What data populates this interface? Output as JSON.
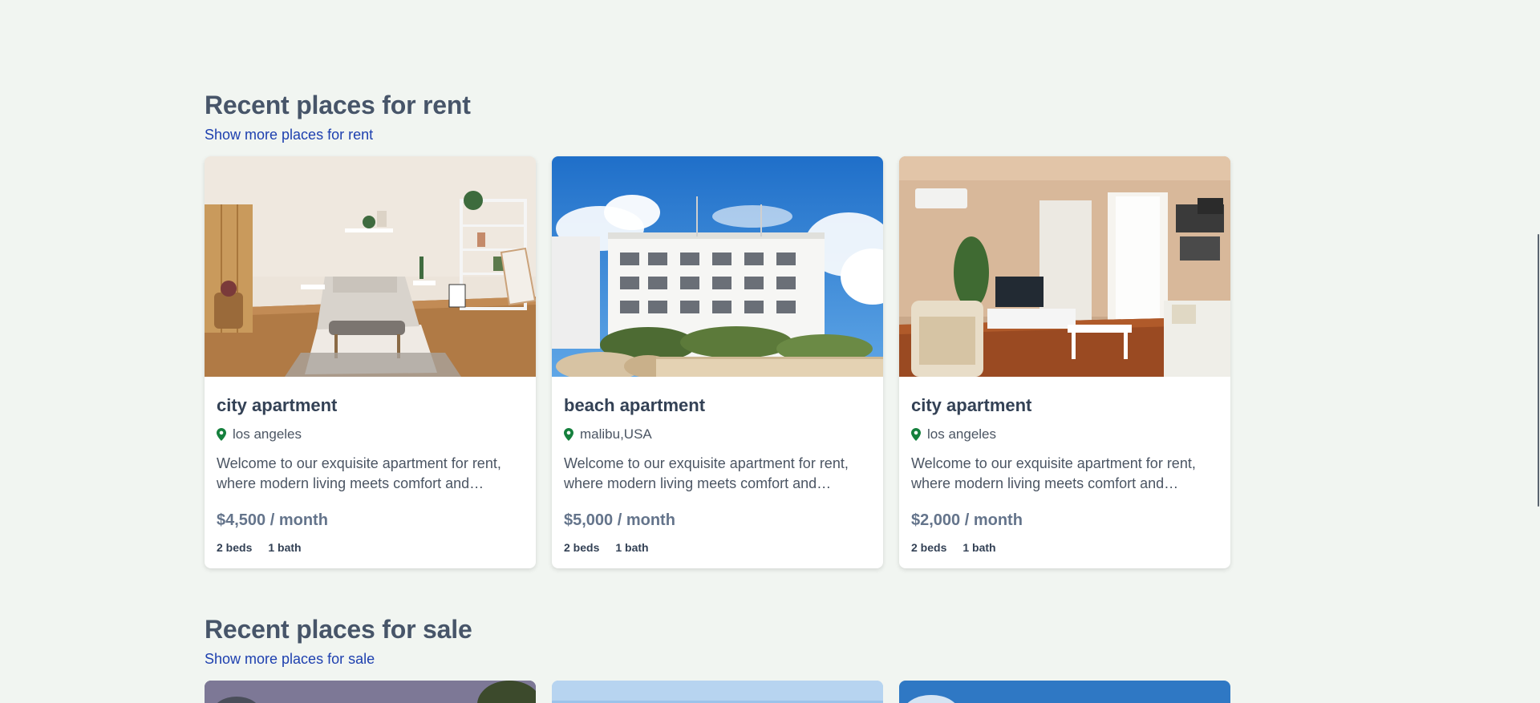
{
  "rent": {
    "title": "Recent places for rent",
    "show_more": "Show more places for rent",
    "listings": [
      {
        "name": "city apartment",
        "location": "los angeles",
        "description": "Welcome to our exquisite apartment for rent, where modern living meets comfort and…",
        "price": "$4,500 / month",
        "beds": "2 beds",
        "baths": "1 bath"
      },
      {
        "name": "beach apartment",
        "location": "malibu,USA",
        "description": "Welcome to our exquisite apartment for rent, where modern living meets comfort and…",
        "price": "$5,000 / month",
        "beds": "2 beds",
        "baths": "1 bath"
      },
      {
        "name": "city apartment",
        "location": "los angeles",
        "description": "Welcome to our exquisite apartment for rent, where modern living meets comfort and…",
        "price": "$2,000 / month",
        "beds": "2 beds",
        "baths": "1 bath"
      }
    ]
  },
  "sale": {
    "title": "Recent places for sale",
    "show_more": "Show more places for sale"
  },
  "colors": {
    "background": "#f1f5f1",
    "heading": "#475569",
    "link": "#1e40af",
    "pin": "#15803d",
    "price": "#64748b"
  }
}
